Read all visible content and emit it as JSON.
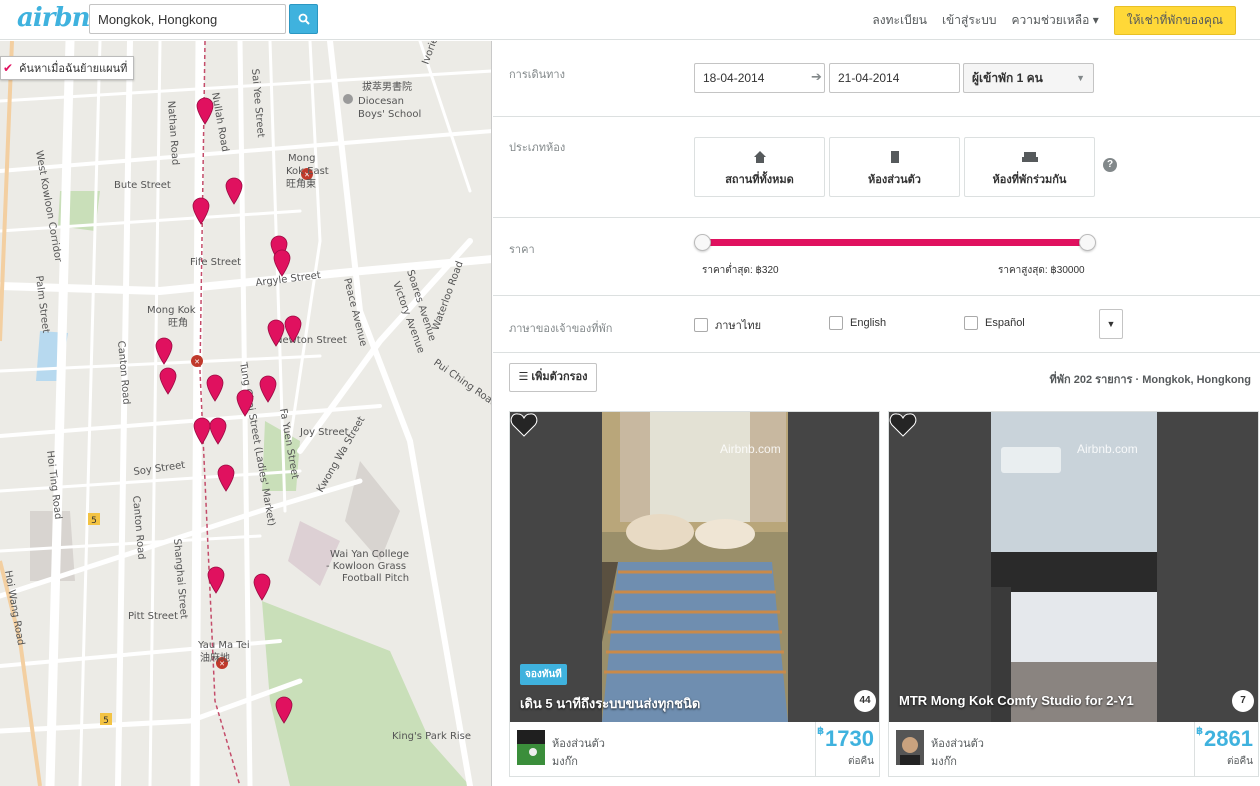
{
  "header": {
    "logo": "airbnb",
    "search_value": "Mongkok, Hongkong",
    "nav": [
      "ลงทะเบียน",
      "เข้าสู่ระบบ",
      "ความช่วยเหลือ ▾"
    ],
    "host_button": "ให้เช่าที่พักของคุณ"
  },
  "map": {
    "checkbox_label": "ค้นหาเมื่อฉันย้ายแผนที่",
    "labels": {
      "nullah_road": "Nullah Road",
      "sai_yee_street": "Sai Yee Street",
      "diocesan": "Diocesan",
      "boys_school": "Boys' School",
      "chinese_school": "拔萃男書院",
      "mong_kok_east_1": "Mong",
      "mong_kok_east_2": "Kok East",
      "mong_kok_east_zh": "旺角東",
      "bute_street": "Bute Street",
      "fife_street": "Fife Street",
      "argyle_street": "Argyle Street",
      "mong_kok": "Mong Kok",
      "mong_kok_zh": "旺角",
      "newton_street": "Newton Street",
      "tung_choi_street": "Tung Choi Street (Ladies' Market)",
      "fa_yuen_street": "Fa Yuen Street",
      "canton_road": "Canton Road",
      "shanghai_street": "Shanghai Street",
      "nathan_road": "Nathan Road",
      "soy_street": "Soy Street",
      "joy_street": "Joy Street",
      "pitt_street": "Pitt Street",
      "yau_ma_tei": "Yau Ma Tei",
      "yau_ma_tei_zh": "油麻地",
      "wai_yan_college": "Wai Yan College",
      "kowloon_grass": "- Kowloon Grass",
      "football_pitch": "Football Pitch",
      "kings_park_rise": "King's Park Rise",
      "west_kowloon_corridor": "West Kowloon Corridor",
      "palm_street": "Palm Street",
      "hoi_ting_road": "Hoi Ting Road",
      "hoi_wang_road": "Hoi Wang Road",
      "kwong_wa_street": "Kwong Wa Street",
      "peace_avenue": "Peace Avenue",
      "victory_avenue": "Victory Avenue",
      "soares_avenue": "Soares Avenue",
      "waterloo_road": "Waterloo Road",
      "pui_ching_road": "Pui Ching Road",
      "boundary_avenue": "Ivorie Avenue",
      "route_5a": "5",
      "route_5b": "5"
    }
  },
  "filters": {
    "dates_label": "การเดินทาง",
    "checkin": "18-04-2014",
    "checkout": "21-04-2014",
    "guests": "ผู้เข้าพัก 1 คน",
    "room_type_label": "ประเภทห้อง",
    "room_types": [
      "สถานที่ทั้งหมด",
      "ห้องส่วนตัว",
      "ห้องที่พักร่วมกัน"
    ],
    "price_label": "ราคา",
    "price_min": "ราคาต่ำสุด: ฿320",
    "price_max": "ราคาสูงสุด: ฿30000",
    "language_label": "ภาษาของเจ้าของที่พัก",
    "languages": [
      "ภาษาไทย",
      "English",
      "Español"
    ],
    "more_filters": "เพิ่มตัวกรอง",
    "result_summary": "ที่พัก 202 รายการ · Mongkok, Hongkong"
  },
  "listings": [
    {
      "title": "เดิน 5 นาทีถึงระบบขนส่งทุกชนิด",
      "badge": "จองทันที",
      "watermark": "Airbnb.com",
      "reviews": "44",
      "room_type": "ห้องส่วนตัว",
      "area": "มงก๊ก",
      "price": "1730",
      "currency": "฿",
      "per_night": "ต่อคืน"
    },
    {
      "title": "MTR Mong Kok Comfy Studio for 2-Y1",
      "watermark": "Airbnb.com",
      "reviews": "7",
      "room_type": "ห้องส่วนตัว",
      "area": "มงก๊ก",
      "price": "2861",
      "currency": "฿",
      "per_night": "ต่อคืน"
    }
  ],
  "colors": {
    "accent": "#3fb2de",
    "pin": "#e0115f",
    "host_yellow": "#ffd838"
  }
}
